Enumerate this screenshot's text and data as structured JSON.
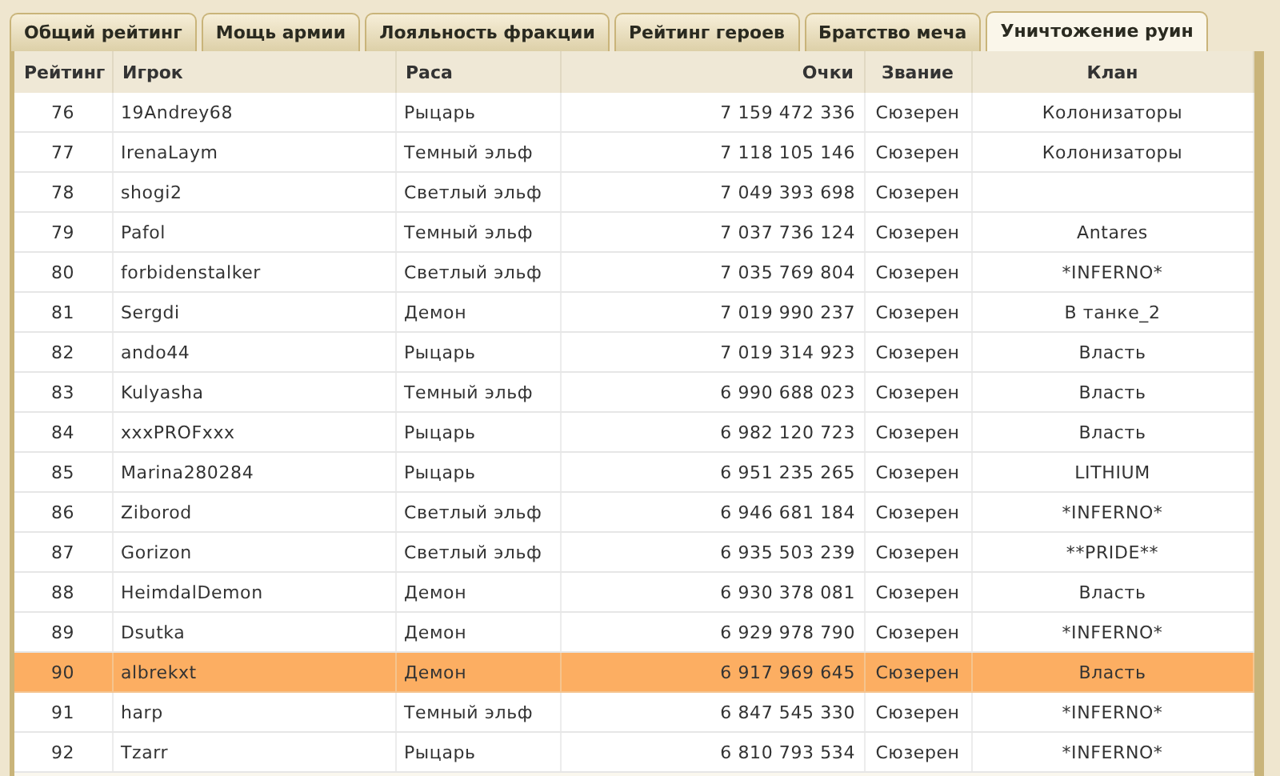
{
  "tabs": [
    {
      "label": "Общий рейтинг",
      "selected": false
    },
    {
      "label": "Мощь армии",
      "selected": false
    },
    {
      "label": "Лояльность фракции",
      "selected": false
    },
    {
      "label": "Рейтинг героев",
      "selected": false
    },
    {
      "label": "Братство меча",
      "selected": false
    },
    {
      "label": "Уничтожение руин",
      "selected": true
    }
  ],
  "table": {
    "columns": [
      "Рейтинг",
      "Игрок",
      "Раса",
      "Очки",
      "Звание",
      "Клан"
    ],
    "rows": [
      {
        "rank": "76",
        "player": "19Andrey68",
        "race": "Рыцарь",
        "points": "7 159 472 336",
        "title": "Сюзерен",
        "clan": "Колонизаторы",
        "selected": false
      },
      {
        "rank": "77",
        "player": "IrenaLaym",
        "race": "Темный эльф",
        "points": "7 118 105 146",
        "title": "Сюзерен",
        "clan": "Колонизаторы",
        "selected": false
      },
      {
        "rank": "78",
        "player": "shogi2",
        "race": "Светлый эльф",
        "points": "7 049 393 698",
        "title": "Сюзерен",
        "selected": false
      },
      {
        "rank": "79",
        "player": "Pafol",
        "race": "Темный эльф",
        "points": "7 037 736 124",
        "title": "Сюзерен",
        "clan": "Antares",
        "selected": false
      },
      {
        "rank": "80",
        "player": "forbidenstalker",
        "race": "Светлый эльф",
        "points": "7 035 769 804",
        "title": "Сюзерен",
        "clan": "*INFERNO*",
        "selected": false
      },
      {
        "rank": "81",
        "player": "Sergdi",
        "race": "Демон",
        "points": "7 019 990 237",
        "title": "Сюзерен",
        "clan": "В танке_2",
        "selected": false
      },
      {
        "rank": "82",
        "player": "ando44",
        "race": "Рыцарь",
        "points": "7 019 314 923",
        "title": "Сюзерен",
        "clan": "Власть",
        "selected": false
      },
      {
        "rank": "83",
        "player": "Kulyasha",
        "race": "Темный эльф",
        "points": "6 990 688 023",
        "title": "Сюзерен",
        "clan": "Власть",
        "selected": false
      },
      {
        "rank": "84",
        "player": "xxxPROFxxx",
        "race": "Рыцарь",
        "points": "6 982 120 723",
        "title": "Сюзерен",
        "clan": "Власть",
        "selected": false
      },
      {
        "rank": "85",
        "player": "Marina280284",
        "race": "Рыцарь",
        "points": "6 951 235 265",
        "title": "Сюзерен",
        "clan": "LITHIUM",
        "selected": false
      },
      {
        "rank": "86",
        "player": "Ziborod",
        "race": "Светлый эльф",
        "points": "6 946 681 184",
        "title": "Сюзерен",
        "clan": "*INFERNO*",
        "selected": false
      },
      {
        "rank": "87",
        "player": "Gorizon",
        "race": "Светлый эльф",
        "points": "6 935 503 239",
        "title": "Сюзерен",
        "clan": "**PRIDE**",
        "selected": false
      },
      {
        "rank": "88",
        "player": "HeimdalDemon",
        "race": "Демон",
        "points": "6 930 378 081",
        "title": "Сюзерен",
        "clan": "Власть",
        "selected": false
      },
      {
        "rank": "89",
        "player": "Dsutka",
        "race": "Демон",
        "points": "6 929 978 790",
        "title": "Сюзерен",
        "clan": "*INFERNO*",
        "selected": false
      },
      {
        "rank": "90",
        "player": "albrekxt",
        "race": "Демон",
        "points": "6 917 969 645",
        "title": "Сюзерен",
        "clan": "Власть",
        "selected": true
      },
      {
        "rank": "91",
        "player": "harp",
        "race": "Темный эльф",
        "points": "6 847 545 330",
        "title": "Сюзерен",
        "clan": "*INFERNO*",
        "selected": false
      },
      {
        "rank": "92",
        "player": "Tzarr",
        "race": "Рыцарь",
        "points": "6 810 793 534",
        "title": "Сюзерен",
        "clan": "*INFERNO*",
        "selected": false
      }
    ]
  }
}
